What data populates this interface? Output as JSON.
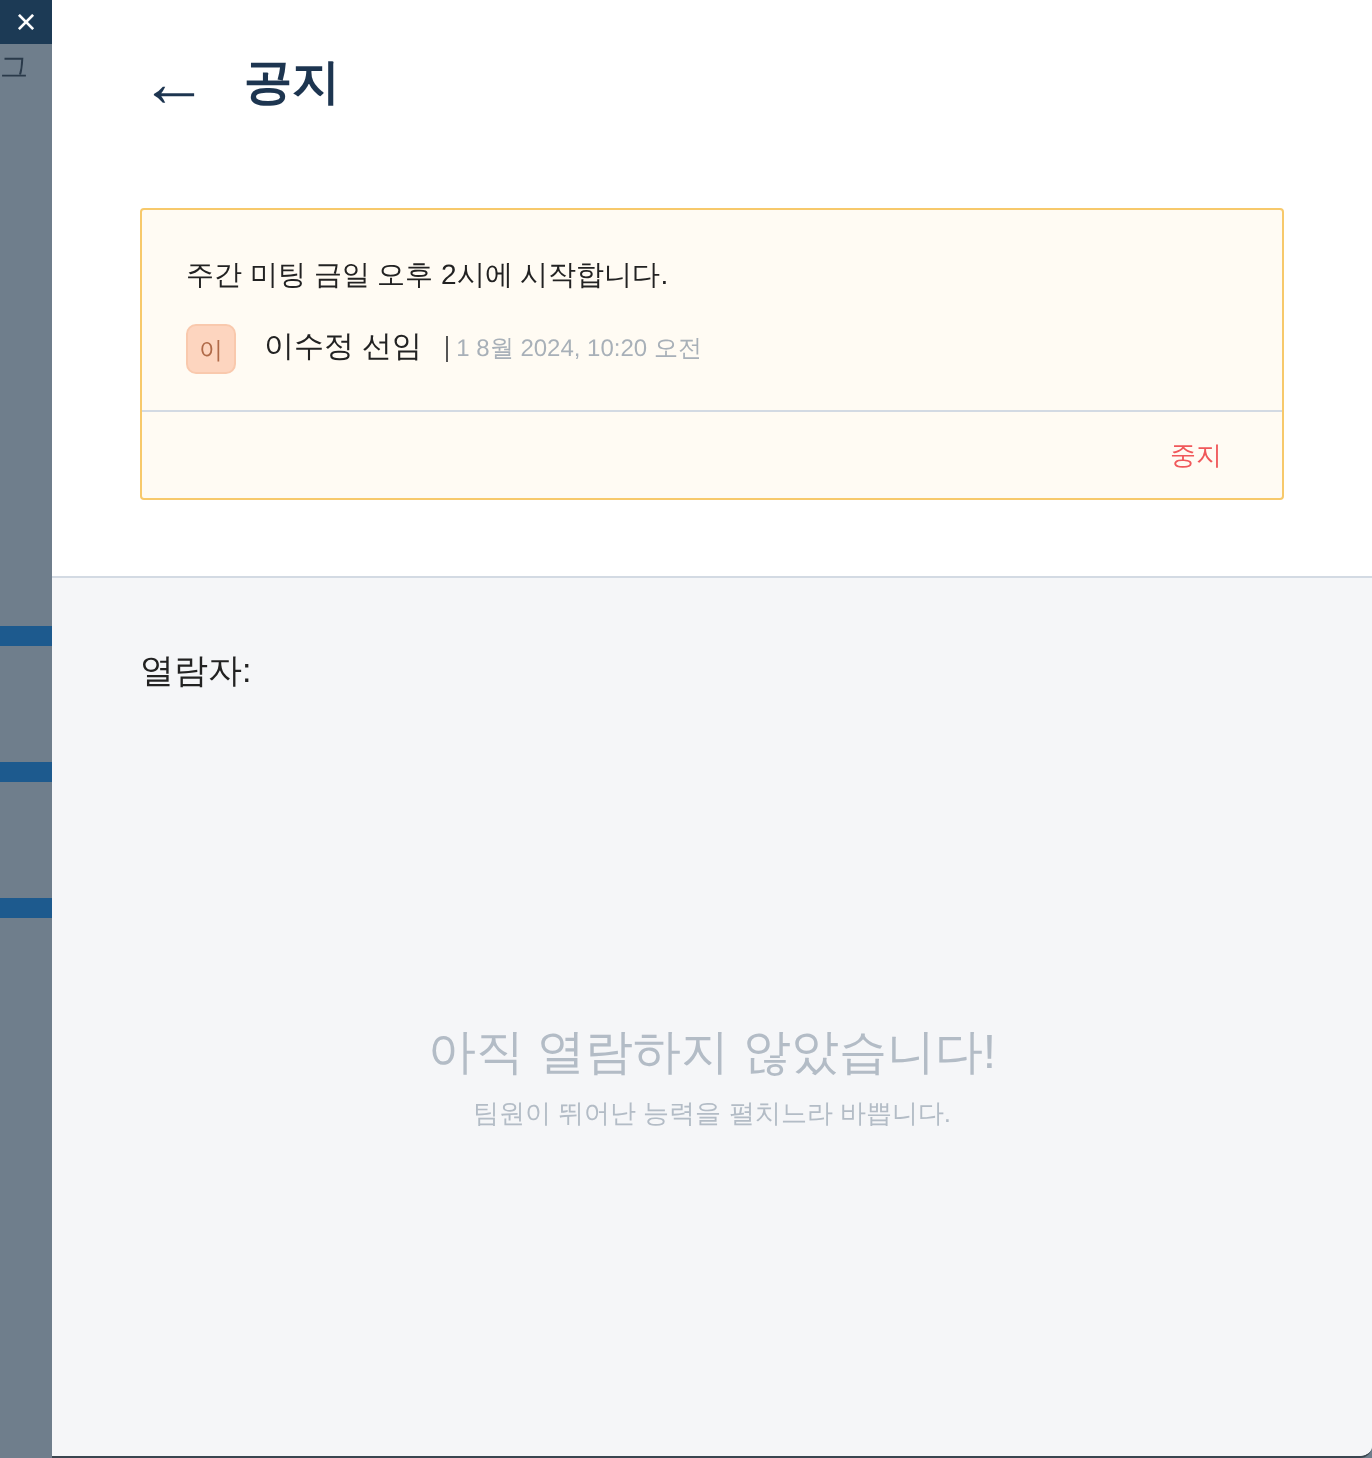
{
  "backdrop": {
    "close": "×",
    "text": "그"
  },
  "header": {
    "back": "←",
    "title": "공지"
  },
  "notice": {
    "message": "주간 미팅 금일 오후 2시에 시작합니다.",
    "avatar": "이",
    "author": "이수정 선임",
    "date": "1 8월 2024, 10:20 오전",
    "action": "중지"
  },
  "viewers": {
    "label": "열람자:",
    "empty_title": "아직 열람하지 않았습니다!",
    "empty_subtitle": "팀원이 뛰어난 능력을 펼치느라 바쁩니다."
  }
}
